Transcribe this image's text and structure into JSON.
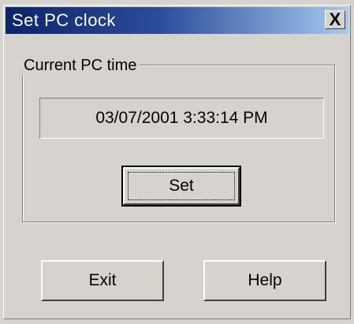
{
  "window": {
    "title": "Set PC clock",
    "close_label": "X"
  },
  "group": {
    "label": "Current PC time",
    "time_value": "03/07/2001 3:33:14 PM"
  },
  "buttons": {
    "set_label": "Set",
    "exit_label": "Exit",
    "help_label": "Help"
  },
  "colors": {
    "dialog_bg": "#d6d3ce",
    "titlebar_start": "#0a246a",
    "titlebar_end": "#a6caf0",
    "title_text": "#ffffff"
  }
}
